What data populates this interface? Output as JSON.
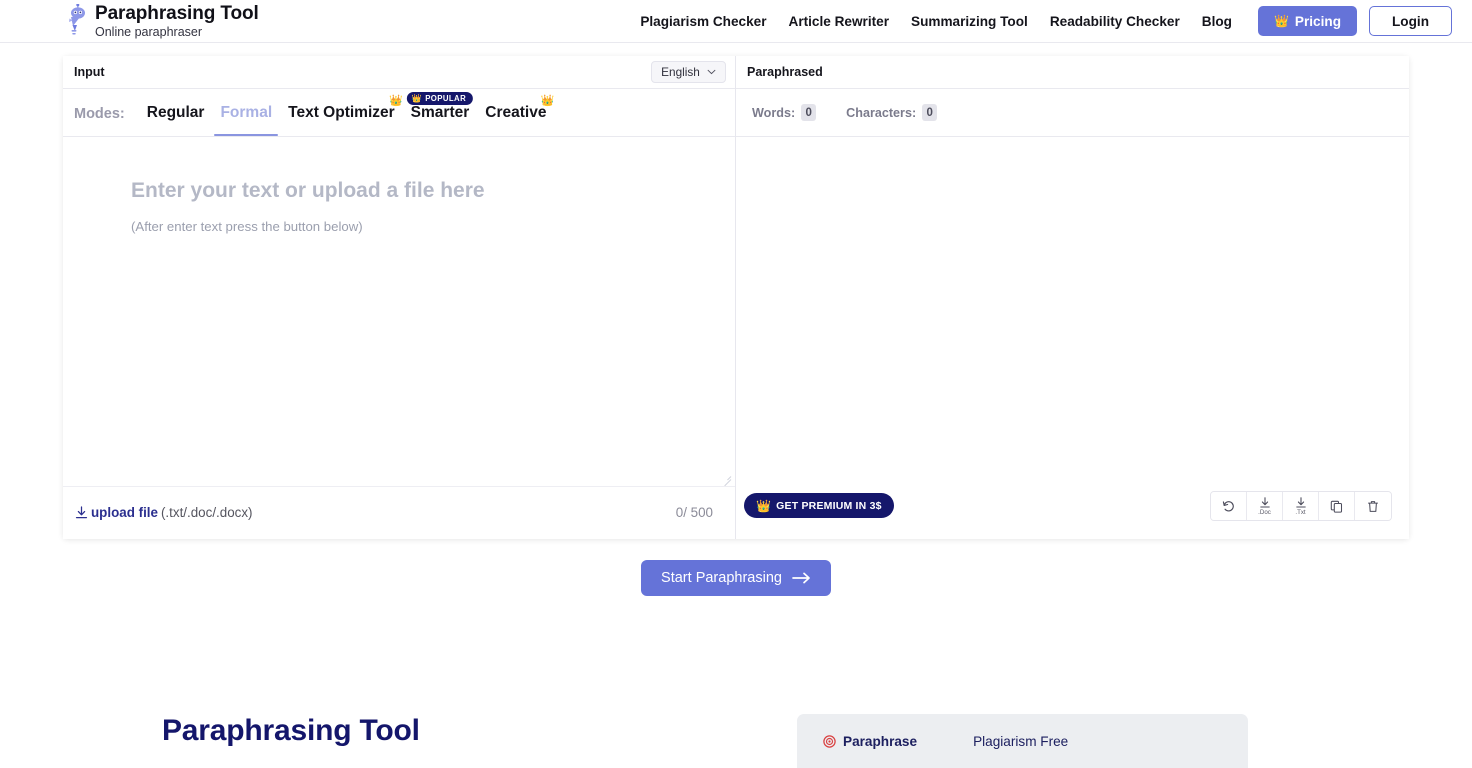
{
  "brand": {
    "icon": "robot-mascot-icon",
    "title": "Paraphrasing Tool",
    "subtitle": "Online paraphraser"
  },
  "nav": {
    "links": [
      {
        "label": "Plagiarism Checker"
      },
      {
        "label": "Article Rewriter"
      },
      {
        "label": "Summarizing Tool"
      },
      {
        "label": "Readability Checker"
      },
      {
        "label": "Blog"
      }
    ],
    "pricing_label": "Pricing",
    "pricing_icon": "crown-icon",
    "pricing_color": "#6573d8",
    "login_label": "Login"
  },
  "input_panel": {
    "title": "Input",
    "language": {
      "value": "English",
      "icon": "chevron-down-icon"
    },
    "modes_label": "Modes:",
    "modes": [
      {
        "label": "Regular",
        "active": false,
        "badge": ""
      },
      {
        "label": "Formal",
        "active": true,
        "badge": ""
      },
      {
        "label": "Text Optimizer",
        "active": false,
        "badge": "crown"
      },
      {
        "label": "Smarter",
        "active": false,
        "badge": "popular",
        "badge_text": "POPULAR"
      },
      {
        "label": "Creative",
        "active": false,
        "badge": "crown"
      }
    ],
    "placeholder": "Enter your text or upload a file here",
    "placeholder_sub": "(After enter text press the button below)",
    "upload": {
      "icon": "download-icon",
      "label": "upload file",
      "extensions": "(.txt/.doc/.docx)"
    },
    "counter": "0/ 500"
  },
  "output_panel": {
    "title": "Paraphrased",
    "stats": [
      {
        "label": "Words:",
        "value": "0"
      },
      {
        "label": "Characters:",
        "value": "0"
      }
    ],
    "premium": {
      "icon": "crown-icon",
      "label": "GET PREMIUM IN 3$"
    },
    "tools": [
      {
        "name": "undo-icon",
        "caption": ""
      },
      {
        "name": "download-doc-icon",
        "caption": ".Doc"
      },
      {
        "name": "download-txt-icon",
        "caption": ".Txt"
      },
      {
        "name": "copy-icon",
        "caption": ""
      },
      {
        "name": "trash-icon",
        "caption": ""
      }
    ]
  },
  "start_button": {
    "label": "Start Paraphrasing",
    "icon": "arrow-right-icon"
  },
  "bottom": {
    "heading": "Paraphrasing Tool",
    "tabs": [
      {
        "label": "Paraphrase",
        "active": true,
        "icon": "target-icon"
      },
      {
        "label": "Plagiarism Free",
        "active": false,
        "icon": ""
      }
    ]
  }
}
